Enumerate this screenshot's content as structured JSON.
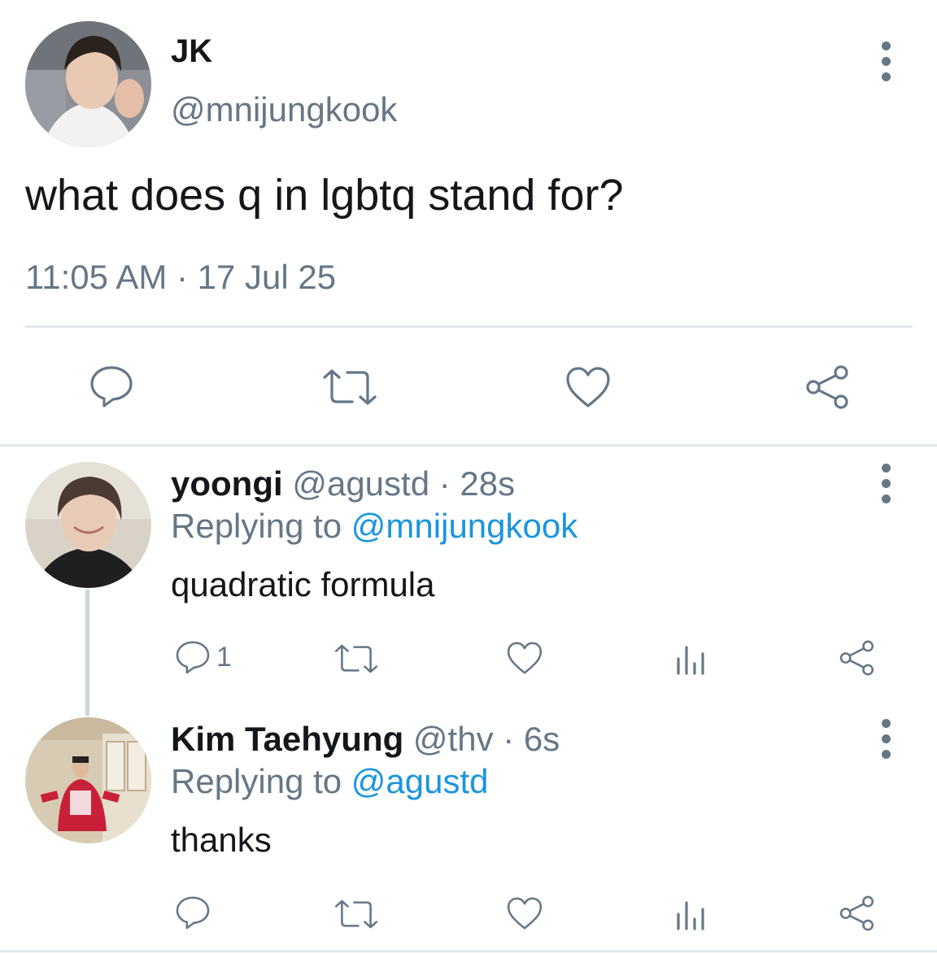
{
  "main_tweet": {
    "display_name": "JK",
    "handle": "@mnijungkook",
    "text": "what does q in lgbtq stand for?",
    "timestamp": "11:05 AM · 17 Jul 25",
    "actions": [
      "reply-icon",
      "retweet-icon",
      "like-icon",
      "share-icon"
    ]
  },
  "replies": [
    {
      "display_name": "yoongi",
      "handle": "@agustd",
      "age": "· 28s",
      "replying_prefix": "Replying to",
      "replying_to": "@mnijungkook",
      "text": "quadratic formula",
      "reply_count": "1"
    },
    {
      "display_name": "Kim Taehyung",
      "handle": "@thv",
      "age": "· 6s",
      "replying_prefix": "Replying to",
      "replying_to": "@agustd",
      "text": "thanks",
      "reply_count": ""
    }
  ],
  "colors": {
    "text": "#14171a",
    "secondary": "#657786",
    "link": "#1b95e0",
    "divider": "#e1e8ed"
  }
}
